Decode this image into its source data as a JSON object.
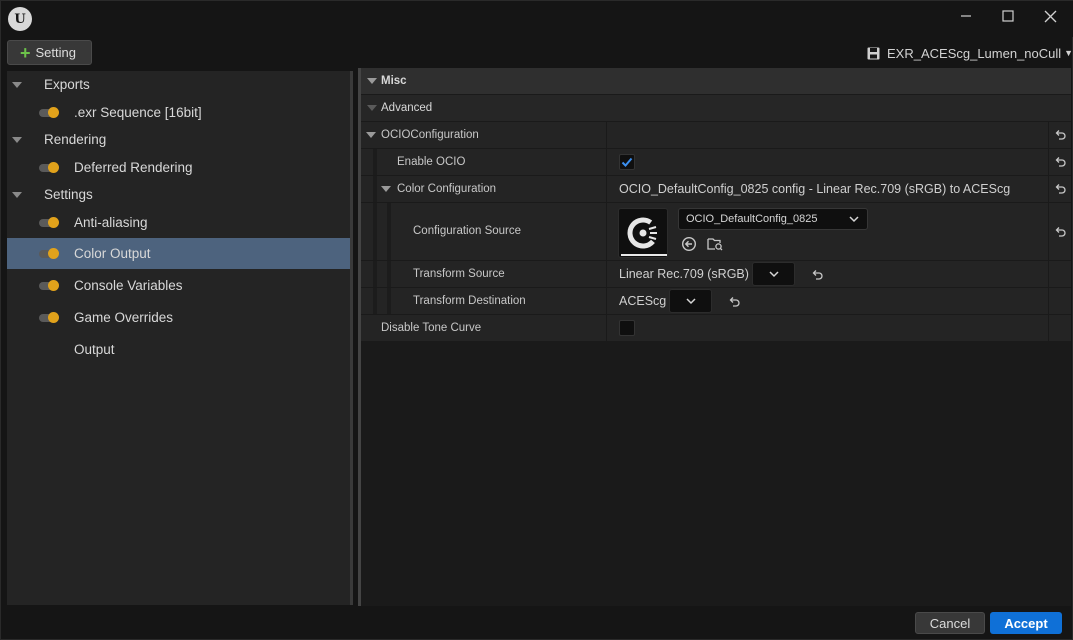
{
  "window": {
    "logo_text": "U",
    "minimize_glyph": "—",
    "maximize_glyph": "☐",
    "close_glyph": "✕"
  },
  "toolbar": {
    "add_setting_label": "Setting",
    "preset_name": "EXR_ACEScg_Lumen_noCull"
  },
  "sidebar": {
    "sections": [
      {
        "label": "Exports"
      },
      {
        "label": "Rendering"
      },
      {
        "label": "Settings"
      }
    ],
    "items": [
      {
        "label": ".exr Sequence [16bit]"
      },
      {
        "label": "Deferred Rendering"
      },
      {
        "label": "Anti-aliasing"
      },
      {
        "label": "Color Output"
      },
      {
        "label": "Console Variables"
      },
      {
        "label": "Game Overrides"
      },
      {
        "label": "Output"
      }
    ],
    "selected": "Color Output"
  },
  "details": {
    "misc_label": "Misc",
    "advanced_label": "Advanced",
    "ocio_config_label": "OCIOConfiguration",
    "enable_ocio": {
      "label": "Enable OCIO",
      "checked": true
    },
    "color_configuration": {
      "label": "Color Configuration",
      "summary": "OCIO_DefaultConfig_0825 config - Linear Rec.709 (sRGB) to ACEScg"
    },
    "configuration_source": {
      "label": "Configuration Source",
      "asset": "OCIO_DefaultConfig_0825"
    },
    "transform_source": {
      "label": "Transform Source",
      "value": "Linear Rec.709 (sRGB)"
    },
    "transform_destination": {
      "label": "Transform Destination",
      "value": "ACEScg"
    },
    "disable_tone_curve": {
      "label": "Disable Tone Curve",
      "checked": false
    }
  },
  "footer": {
    "cancel_label": "Cancel",
    "accept_label": "Accept"
  },
  "colors": {
    "accent": "#0f70d7",
    "toggle_on": "#e1a21b",
    "selection": "#4d637e",
    "add_icon": "#6cc24a"
  }
}
